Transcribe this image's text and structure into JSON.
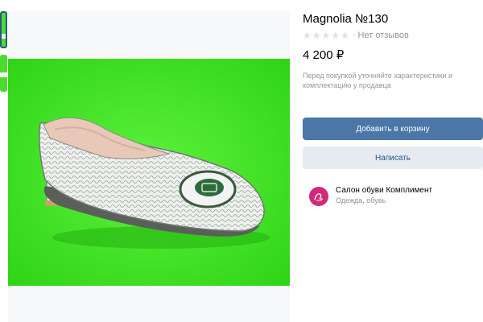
{
  "product": {
    "title": "Magnolia №130",
    "rating_stars": 0,
    "rating_max": 5,
    "reviews_text": "· Нет отзывов",
    "price": "4 200 ₽",
    "note": "Перед покупкой уточняйте характеристики и комплектацию у продавца"
  },
  "actions": {
    "add_to_cart": "Добавить в корзину",
    "write": "Написать"
  },
  "seller": {
    "name": "Салон обуви Комплимент",
    "category": "Одежда, обувь"
  },
  "gallery": {
    "thumbnail_count": 2,
    "selected_index": 0
  },
  "colors": {
    "primary_button": "#4a76a8",
    "secondary_button": "#e5ebf1",
    "link_text": "#2a5885",
    "muted_text": "#939699",
    "photo_background": "#39e021",
    "avatar": "#d22a7a"
  },
  "icons": {
    "star": "star-icon",
    "seller_logo": "seller-logo-icon"
  }
}
